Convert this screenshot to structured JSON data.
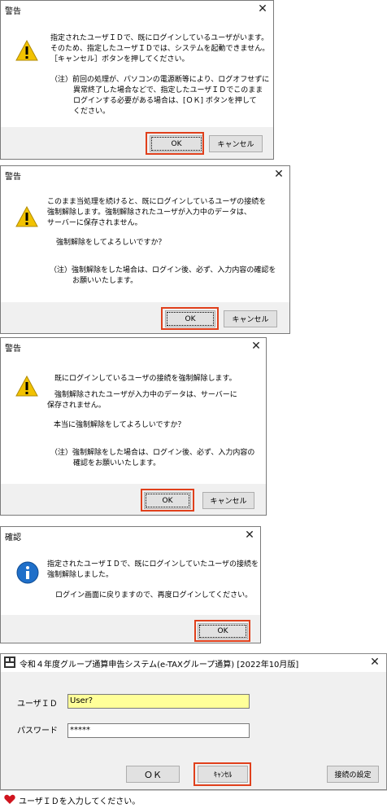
{
  "dialog1": {
    "title": "警告",
    "lines": [
      "指定されたユーザＩＤで、既にログインしているユーザがいます。",
      "そのため、指定したユーザＩＤでは、システムを起動できません。",
      "［キャンセル］ボタンを押してください。"
    ],
    "note_lines": [
      "（注）前回の処理が、パソコンの電源断等により、ログオフせずに",
      "異常終了した場合などで、指定したユーザＩＤでこのまま",
      "ログインする必要がある場合は、[ＯＫ] ボタンを押して",
      "ください。"
    ],
    "ok": "OK",
    "cancel": "キャンセル"
  },
  "dialog2": {
    "title": "警告",
    "lines": [
      "このまま当処理を続けると、既にログインしているユーザの接続を",
      "強制解除します。強制解除されたユーザが入力中のデータは、",
      "サーバーに保存されません。"
    ],
    "question": "強制解除をしてよろしいですか？",
    "note_lines": [
      "（注）強制解除をした場合は、ログイン後、必ず、入力内容の確認を",
      "お願いいたします。"
    ],
    "ok": "OK",
    "cancel": "キャンセル"
  },
  "dialog3": {
    "title": "警告",
    "line1": "既にログインしているユーザの接続を強制解除します。",
    "lines": [
      "強制解除されたユーザが入力中のデータは、サーバーに",
      "保存されません。"
    ],
    "question": "本当に強制解除をしてよろしいですか？",
    "note_lines": [
      "（注）強制解除をした場合は、ログイン後、必ず、入力内容の",
      "確認をお願いいたします。"
    ],
    "ok": "OK",
    "cancel": "キャンセル"
  },
  "dialog4": {
    "title": "確認",
    "lines": [
      "指定されたユーザＩＤで、既にログインしていたユーザの接続を",
      "強制解除しました。"
    ],
    "line2": "ログイン画面に戻りますので、再度ログインしてください。",
    "ok": "OK"
  },
  "login": {
    "title": "令和４年度グループ通算申告システム(e-TAXグループ通算) [2022年10月版]",
    "userid_label": "ユーザＩＤ",
    "userid_value": "User?",
    "password_label": "パスワード",
    "password_value": "*****",
    "ok": "ＯＫ",
    "cancel": "ｷｬﾝｾﾙ",
    "settings": "接続の設定",
    "status": "ユーザＩＤを入力してください。"
  },
  "colors": {
    "highlight": "#e0401c",
    "field_yellow": "#ffff99",
    "warning": "#f2c200",
    "info": "#1f6fc9"
  }
}
